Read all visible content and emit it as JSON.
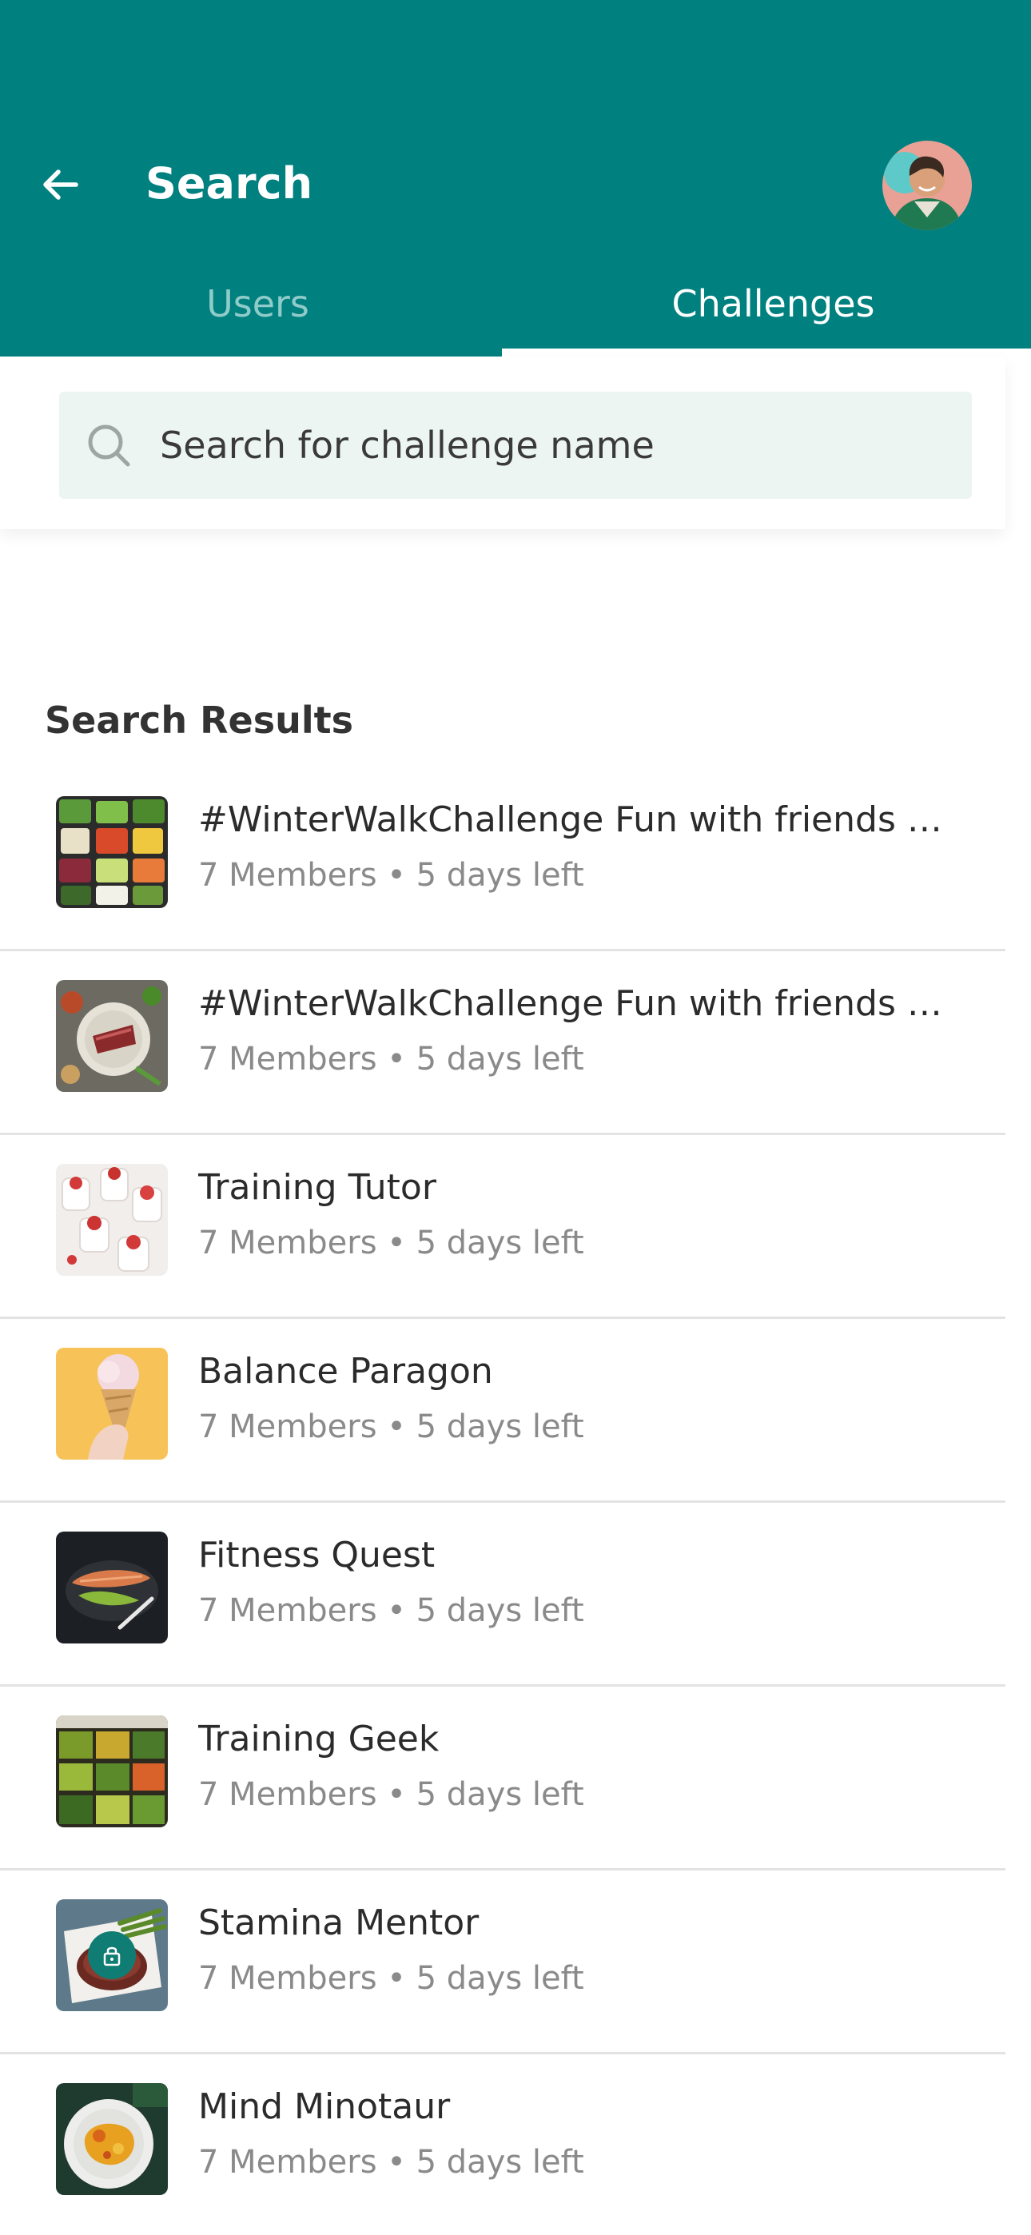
{
  "header": {
    "title": "Search",
    "back_icon": "arrow-left-icon",
    "avatar_icon": "user-avatar"
  },
  "tabs": [
    {
      "label": "Users",
      "active": false
    },
    {
      "label": "Challenges",
      "active": true
    }
  ],
  "search": {
    "placeholder": "Search for challenge name",
    "value": ""
  },
  "results": {
    "title": "Search Results",
    "items": [
      {
        "title": "#WinterWalkChallenge Fun with friends enj...",
        "members": "7 Members",
        "separator": "•",
        "time_left": "5 days left",
        "thumb": "salad-bowls",
        "locked": false
      },
      {
        "title": "#WinterWalkChallenge Fun with friends enj...",
        "members": "7 Members",
        "separator": "•",
        "time_left": "5 days left",
        "thumb": "steak-plate",
        "locked": false
      },
      {
        "title": "Training Tutor",
        "members": "7 Members",
        "separator": "•",
        "time_left": "5 days left",
        "thumb": "berry-desserts",
        "locked": false
      },
      {
        "title": "Balance Paragon",
        "members": "7 Members",
        "separator": "•",
        "time_left": "5 days left",
        "thumb": "ice-cream-cone",
        "locked": false
      },
      {
        "title": "Fitness Quest",
        "members": "7 Members",
        "separator": "•",
        "time_left": "5 days left",
        "thumb": "salmon-dish",
        "locked": false
      },
      {
        "title": "Training Geek",
        "members": "7 Members",
        "separator": "•",
        "time_left": "5 days left",
        "thumb": "vegetable-market",
        "locked": false
      },
      {
        "title": "Stamina Mentor",
        "members": "7 Members",
        "separator": "•",
        "time_left": "5 days left",
        "thumb": "steak-asparagus",
        "locked": true
      },
      {
        "title": "Mind Minotaur",
        "members": "7 Members",
        "separator": "•",
        "time_left": "5 days left",
        "thumb": "curry-plate",
        "locked": false
      }
    ]
  },
  "colors": {
    "primary": "#00807f",
    "search_bg": "#edf5f3",
    "tab_inactive": "#8fcbc9",
    "meta_text": "#8a8a8a",
    "lock_badge": "#0f7d74"
  }
}
